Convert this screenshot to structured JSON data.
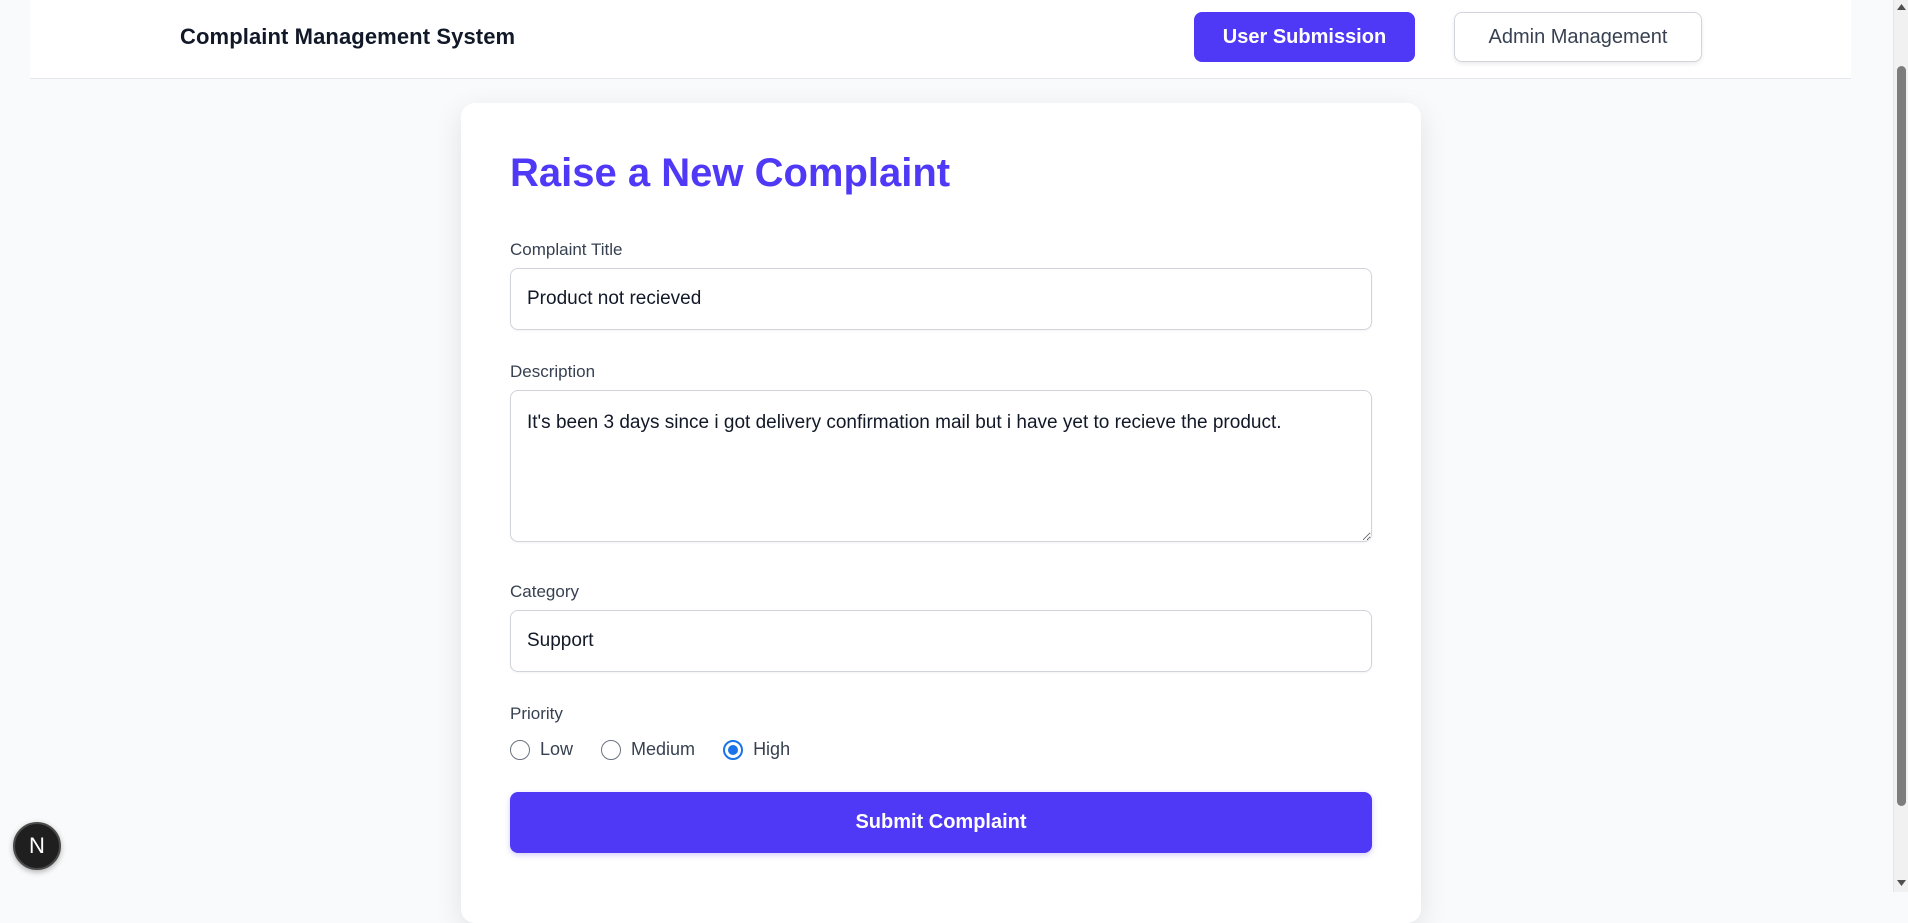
{
  "header": {
    "brand": "Complaint Management System",
    "nav": [
      {
        "label": "User Submission",
        "active": true
      },
      {
        "label": "Admin Management",
        "active": false
      }
    ]
  },
  "form": {
    "title": "Raise a New Complaint",
    "fields": {
      "title": {
        "label": "Complaint Title",
        "value": "Product not recieved"
      },
      "description": {
        "label": "Description",
        "value": "It's been 3 days since i got delivery confirmation mail but i have yet to recieve the product."
      },
      "category": {
        "label": "Category",
        "value": "Support"
      }
    },
    "priority": {
      "label": "Priority",
      "options": [
        "Low",
        "Medium",
        "High"
      ],
      "selected": "High"
    },
    "submit_label": "Submit Complaint"
  },
  "badge": {
    "letter": "N"
  },
  "colors": {
    "accent": "#4f39f6",
    "radio_checked": "#1a73e8",
    "background": "#f9fafb"
  },
  "icons": {
    "badge": "nextjs-logo-icon",
    "scroll_up": "scroll-up-arrow-icon",
    "scroll_down": "scroll-down-arrow-icon"
  }
}
